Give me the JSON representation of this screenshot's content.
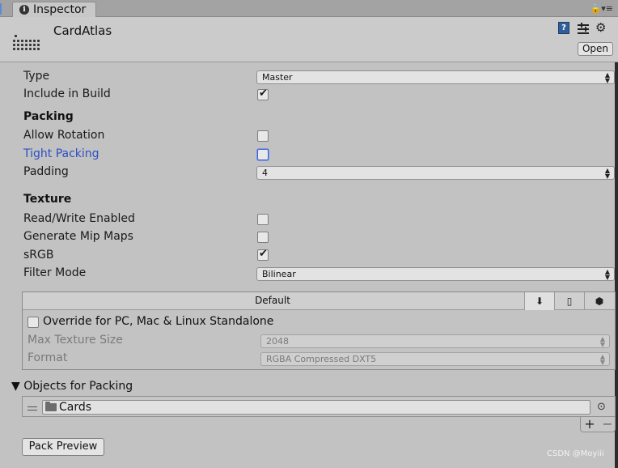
{
  "tab": {
    "title": "Inspector",
    "lock": "🔒▾≡"
  },
  "header": {
    "asset_name": "CardAtlas",
    "open_label": "Open"
  },
  "fields": {
    "type_label": "Type",
    "type_value": "Master",
    "include_label": "Include in Build",
    "packing_heading": "Packing",
    "allow_rotation_label": "Allow Rotation",
    "tight_packing_label": "Tight Packing",
    "padding_label": "Padding",
    "padding_value": "4",
    "texture_heading": "Texture",
    "readwrite_label": "Read/Write Enabled",
    "mipmaps_label": "Generate Mip Maps",
    "srgb_label": "sRGB",
    "filter_label": "Filter Mode",
    "filter_value": "Bilinear"
  },
  "platform": {
    "title": "Default",
    "override_label": "Override for PC, Mac & Linux Standalone",
    "max_size_label": "Max Texture Size",
    "max_size_value": "2048",
    "format_label": "Format",
    "format_value": "RGBA Compressed DXT5"
  },
  "objects": {
    "heading": "Objects for Packing",
    "items": [
      "Cards"
    ]
  },
  "footer": {
    "pack_label": "Pack Preview",
    "watermark": "CSDN @Moyiii"
  }
}
